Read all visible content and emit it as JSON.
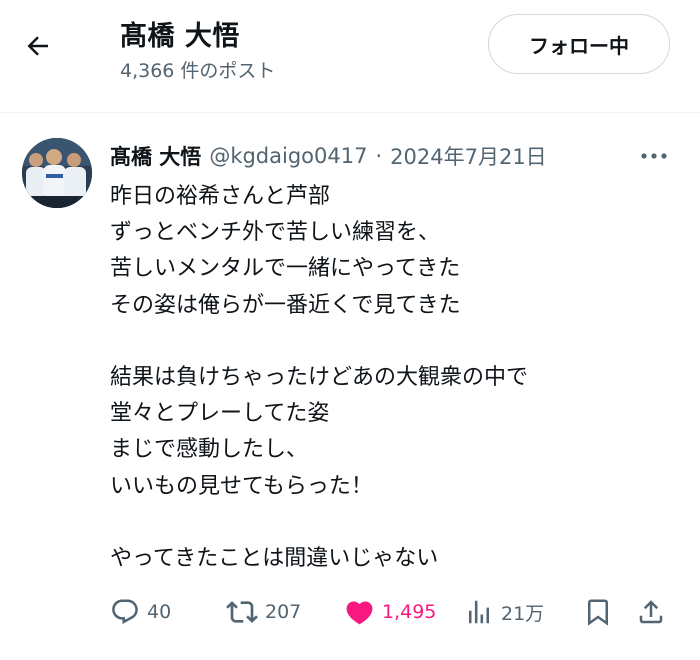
{
  "header": {
    "name": "髙橋 大悟",
    "post_count": "4,366 件のポスト",
    "follow_label": "フォロー中"
  },
  "tweet": {
    "author_name": "髙橋 大悟",
    "handle": "@kgdaigo0417",
    "separator": "·",
    "date": "2024年7月21日",
    "lines": [
      "昨日の裕希さんと芦部",
      "ずっとベンチ外で苦しい練習を、",
      "苦しいメンタルで一緒にやってきた",
      "その姿は俺らが一番近くで見てきた",
      "",
      "結果は負けちゃったけどあの大観衆の中で",
      "堂々とプレーしてた姿",
      "まじで感動したし、",
      "いいもの見せてもらった！",
      "",
      "やってきたことは間違いじゃない"
    ],
    "stats": {
      "replies": "40",
      "reposts": "207",
      "likes": "1,495",
      "views": "21万"
    }
  },
  "icons": {
    "back": "arrow-left-icon",
    "more": "more-dots-icon",
    "reply": "reply-icon",
    "repost": "repost-icon",
    "like": "heart-icon",
    "views": "views-icon",
    "bookmark": "bookmark-icon",
    "share": "share-icon"
  },
  "colors": {
    "text": "#0f1419",
    "secondary": "#536471",
    "like": "#f91880",
    "border": "#cfd9de"
  }
}
